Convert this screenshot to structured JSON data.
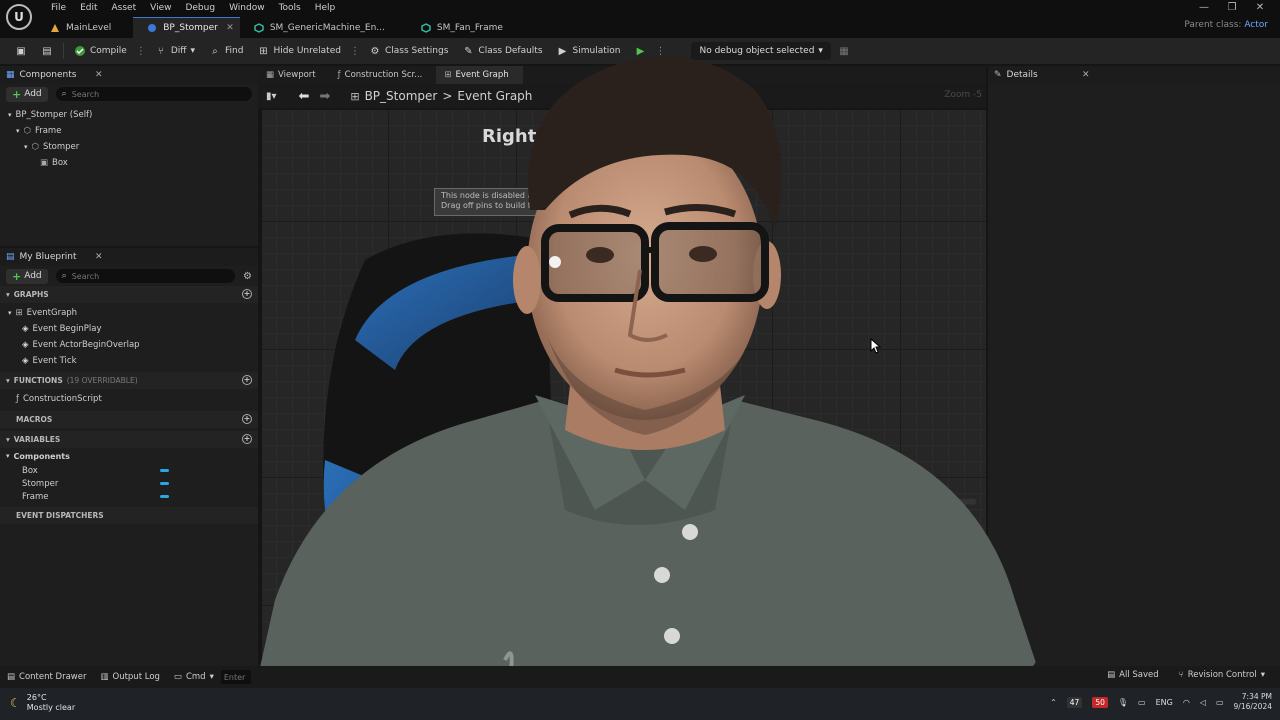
{
  "app": {
    "logo_text": "U",
    "menu": [
      "File",
      "Edit",
      "Asset",
      "View",
      "Debug",
      "Window",
      "Tools",
      "Help"
    ],
    "window_controls": [
      "—",
      "❐",
      "✕"
    ],
    "parent_class_label": "Parent class:",
    "parent_class_value": "Actor"
  },
  "doc_tabs": [
    {
      "label": "MainLevel",
      "active": false,
      "color": "#e3a83b"
    },
    {
      "label": "BP_Stomper",
      "active": true,
      "color": "#3b78d8"
    },
    {
      "label": "SM_GenericMachine_En...",
      "active": false,
      "color": "#2fc4a8"
    },
    {
      "label": "SM_Fan_Frame",
      "active": false,
      "color": "#2fc4a8"
    }
  ],
  "toolbar": {
    "compile": "Compile",
    "diff": "Diff",
    "find": "Find",
    "hide_unrelated": "Hide Unrelated",
    "class_settings": "Class Settings",
    "class_defaults": "Class Defaults",
    "simulation": "Simulation",
    "debug_object": "No debug object selected"
  },
  "components_panel": {
    "title": "Components",
    "add_label": "Add",
    "search_placeholder": "Search",
    "tree": [
      {
        "label": "BP_Stomper (Self)",
        "indent": 0
      },
      {
        "label": "Frame",
        "indent": 1
      },
      {
        "label": "Stomper",
        "indent": 2
      },
      {
        "label": "Box",
        "indent": 3
      }
    ]
  },
  "my_blueprint": {
    "title": "My Blueprint",
    "add_label": "Add",
    "search_placeholder": "Search",
    "graphs_header": "GRAPHS",
    "graph_root": "EventGraph",
    "events": [
      "Event BeginPlay",
      "Event ActorBeginOverlap",
      "Event Tick"
    ],
    "functions_header": "FUNCTIONS",
    "functions_sub": "(19 OVERRIDABLE)",
    "functions": [
      "ConstructionScript"
    ],
    "macros_header": "MACROS",
    "variables_header": "VARIABLES",
    "variables_group": "Components",
    "variables": [
      "Box",
      "Stomper",
      "Frame"
    ],
    "dispatchers_header": "EVENT DISPATCHERS"
  },
  "graph": {
    "tabs": [
      "Viewport",
      "Construction Scr...",
      "Event Graph"
    ],
    "active_tab": 2,
    "breadcrumb_root": "BP_Stomper",
    "breadcrumb_separator": ">",
    "breadcrumb_leaf": "Event Graph",
    "zoom": "Zoom -5",
    "canvas_title": "Right-",
    "disabled_note_line1": "This node is disabled and",
    "disabled_note_line2": "Drag off pins to build func",
    "watermark": "T"
  },
  "details_panel": {
    "title": "Details"
  },
  "statusbar": {
    "content_drawer": "Content Drawer",
    "output_log": "Output Log",
    "cmd": "Cmd",
    "console_placeholder": "Enter",
    "all_saved": "All Saved",
    "revision_control": "Revision Control"
  },
  "taskbar": {
    "temperature": "26°C",
    "weather": "Mostly clear",
    "badge_1": "47",
    "badge_2": "50",
    "language": "ENG",
    "time": "7:34 PM",
    "date": "9/16/2024"
  },
  "colors": {
    "accent": "#3b78d8",
    "add_plus": "#4fc44f",
    "variable_pill": "#27a9e6"
  }
}
